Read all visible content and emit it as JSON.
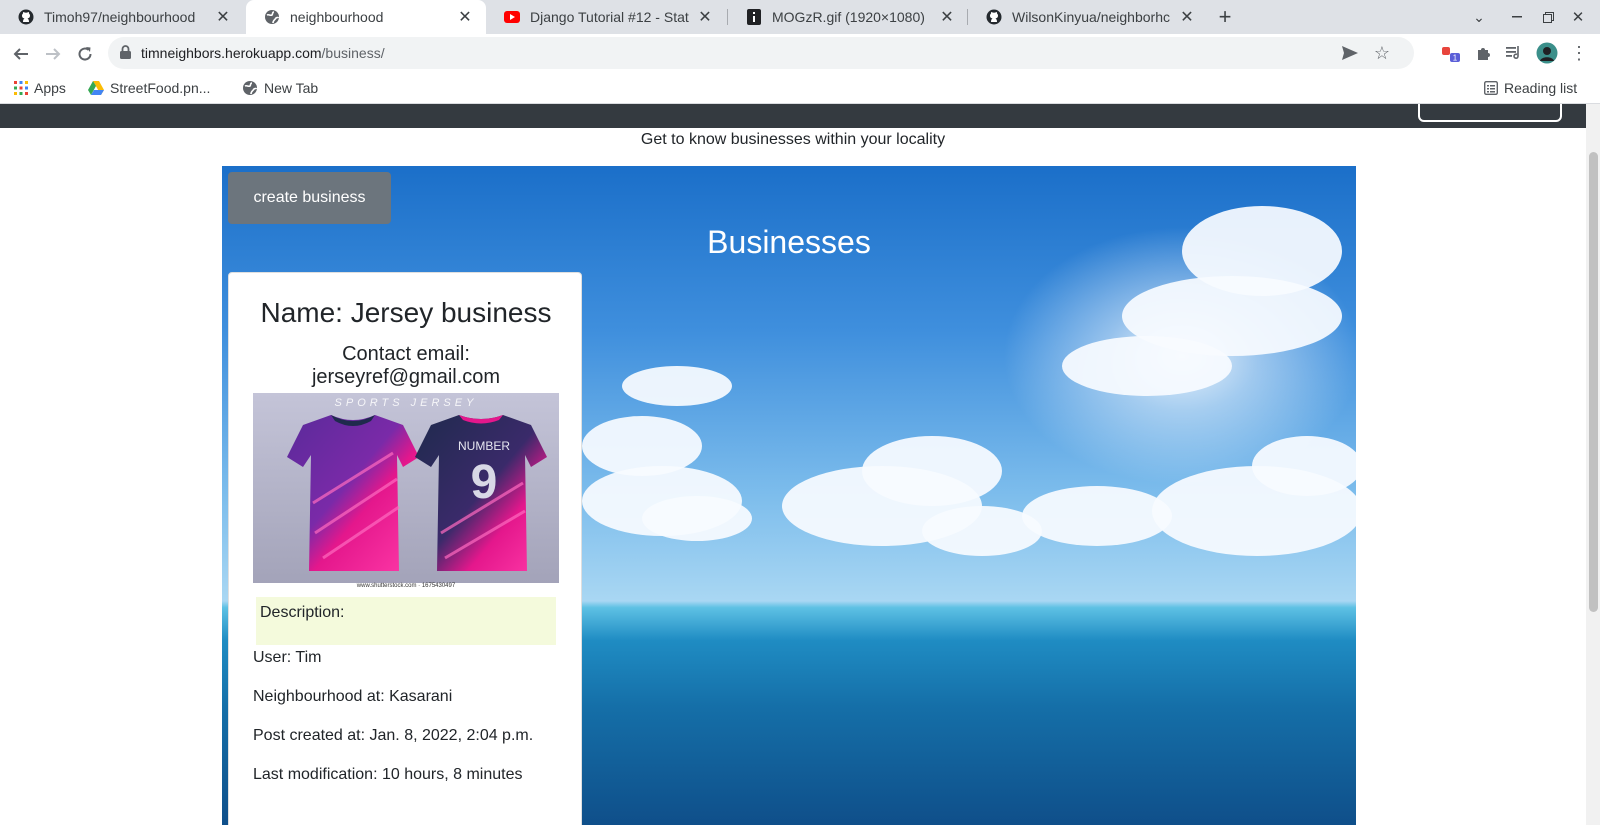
{
  "browser": {
    "tabs": [
      {
        "title": "Timoh97/neighbourhood",
        "favicon": "github-icon",
        "active": false
      },
      {
        "title": "neighbourhood",
        "favicon": "globe-icon",
        "active": true
      },
      {
        "title": "Django Tutorial #12 - Stat",
        "favicon": "youtube-icon",
        "active": false
      },
      {
        "title": "MOGzR.gif (1920×1080)",
        "favicon": "image-file-icon",
        "active": false
      },
      {
        "title": "WilsonKinyua/neighborhc",
        "favicon": "github-icon",
        "active": false
      }
    ],
    "new_tab_label": "+",
    "url_host": "timneighbors.herokuapp.com",
    "url_path": "/business/",
    "bookmarks": [
      {
        "label": "Apps",
        "icon": "apps-grid-icon"
      },
      {
        "label": "StreetFood.pn...",
        "icon": "google-drive-icon"
      },
      {
        "label": "New Tab",
        "icon": "globe-icon"
      }
    ],
    "reading_list_label": "Reading list",
    "extension_badge": "1"
  },
  "page": {
    "tagline": "Get to know businesses within your locality",
    "create_button_label": "create business",
    "heading": "Businesses",
    "business": {
      "name": "Name: Jersey business",
      "contact_label": "Contact email:",
      "email": "jerseyref@gmail.com",
      "image_caption": "SPORTS JERSEY",
      "image_number_text": "NUMBER",
      "image_number": "9",
      "image_footer": "www.shutterstock.com · 1675430497",
      "description_label": "Description:",
      "user": "User: Tim",
      "neighbourhood": "Neighbourhood at: Kasarani",
      "created": "Post created at: Jan. 8, 2022, 2:04 p.m.",
      "modified": "Last modification: 10 hours, 8 minutes"
    }
  },
  "colors": {
    "navbar": "#343a40",
    "button": "#6c757d",
    "description_bg": "#f4fadc",
    "jersey_pink": "#e4178c",
    "jersey_navy": "#1f2a4d"
  }
}
